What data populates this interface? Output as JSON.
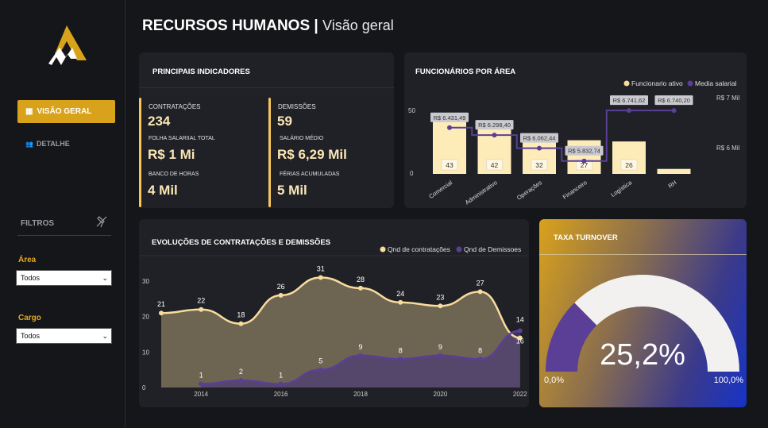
{
  "sidebar": {
    "nav_active": "VISÃO GERAL",
    "nav_item": "DETALHE",
    "filtros": "FILTROS",
    "filters": [
      {
        "label": "Área",
        "value": "Todos"
      },
      {
        "label": "Cargo",
        "value": "Todos"
      }
    ]
  },
  "header": {
    "title": "RECURSOS HUMANOS |",
    "subtitle": "Visão geral"
  },
  "kpi": {
    "title": "PRINCIPAIS INDICADORES",
    "left": [
      {
        "label": "CONTRATAÇÕES",
        "value": "234"
      },
      {
        "label": "FOLHA SALARIIAL TOTAL",
        "value": "R$ 1 Mi"
      },
      {
        "label": "BANCO DE HORAS",
        "value": "4 Mil"
      }
    ],
    "right": [
      {
        "label": "DEMISSÕES",
        "value": "59"
      },
      {
        "label": "SALÁRIO MÉDIO",
        "value": "R$ 6,29 Mil"
      },
      {
        "label": "FÉRIAS ACUMULADAS",
        "value": "5 Mil"
      }
    ]
  },
  "colors": {
    "accent": "#d9a21b",
    "bar": "#fdebb8",
    "purple": "#5b3f96",
    "cream": "#f7dc9c"
  },
  "chart_data": [
    {
      "type": "bar",
      "title": "FUNCIONÁRIOS POR ÁREA",
      "categories": [
        "Comercial",
        "Administrativo",
        "Operações",
        "Financeiro",
        "Logística",
        "RH"
      ],
      "series": [
        {
          "name": "Funcionario ativo",
          "values": [
            43,
            42,
            32,
            27,
            26,
            4
          ]
        },
        {
          "name": "Media salarial",
          "values": [
            6431.49,
            6298.4,
            6062.44,
            5832.74,
            6741.62,
            6740.2
          ]
        }
      ],
      "data_labels": [
        "R$ 6.431,49",
        "R$ 6.298,40",
        "R$ 6.062,44",
        "R$ 5.832,74",
        "R$ 6.741,62",
        "R$ 6.740,20"
      ],
      "y_ticks": [
        "50",
        "0"
      ],
      "y2_ticks": [
        "R$ 7 Mil",
        "R$ 6 Mil"
      ],
      "ylim": [
        0,
        55
      ],
      "y2lim": [
        5600,
        7000
      ]
    },
    {
      "type": "area",
      "title": "EVOLUÇÕES DE CONTRATAÇÕES E DEMISSÕES",
      "x": [
        2013,
        2014,
        2015,
        2016,
        2017,
        2018,
        2019,
        2020,
        2021,
        2022
      ],
      "x_ticks": [
        "2014",
        "2016",
        "2018",
        "2020",
        "2022"
      ],
      "y_ticks": [
        "30",
        "20",
        "10",
        "0"
      ],
      "ylim": [
        0,
        33
      ],
      "series": [
        {
          "name": "Qnd de contratações",
          "values": [
            21,
            22,
            18,
            26,
            31,
            28,
            24,
            23,
            27,
            14
          ]
        },
        {
          "name": "Qnd de Demissoes",
          "values": [
            null,
            1,
            2,
            1,
            5,
            9,
            8,
            9,
            8,
            16
          ]
        }
      ]
    },
    {
      "type": "gauge",
      "title": "TAXA TURNOVER",
      "value": 25.2,
      "value_label": "25,2%",
      "min_label": "0,0%",
      "max_label": "100,0%"
    }
  ]
}
